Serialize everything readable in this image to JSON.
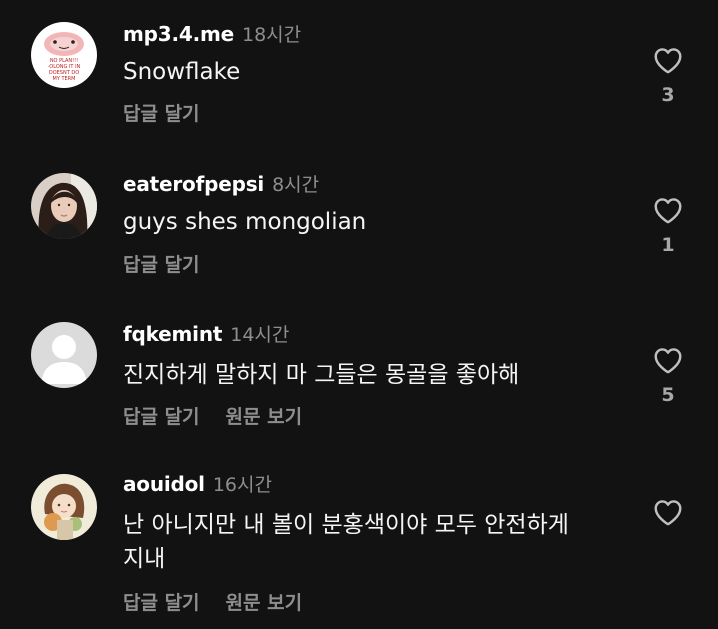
{
  "comments": [
    {
      "username": "mp3.4.me",
      "time": "18시간",
      "text": "Snowflake",
      "reply": "답글 달기",
      "likes": "3",
      "avatar_text": [
        "NO PLAN!!!",
        "·OLONG IT IN",
        "DOESNT DO",
        "MY TERM"
      ]
    },
    {
      "username": "eaterofpepsi",
      "time": "8시간",
      "text": "guys shes mongolian",
      "reply": "답글 달기",
      "likes": "1"
    },
    {
      "username": "fqkemint",
      "time": "14시간",
      "text": "진지하게 말하지 마 그들은 몽골을 좋아해",
      "reply": "답글 달기",
      "see_original": "원문 보기",
      "likes": "5"
    },
    {
      "username": "aouidol",
      "time": "16시간",
      "text_line1": "난 아니지만 내 볼이 분홍색이야 모두 안전하게",
      "text_line2": "지내",
      "reply": "답글 달기",
      "see_original": "원문 보기"
    }
  ]
}
